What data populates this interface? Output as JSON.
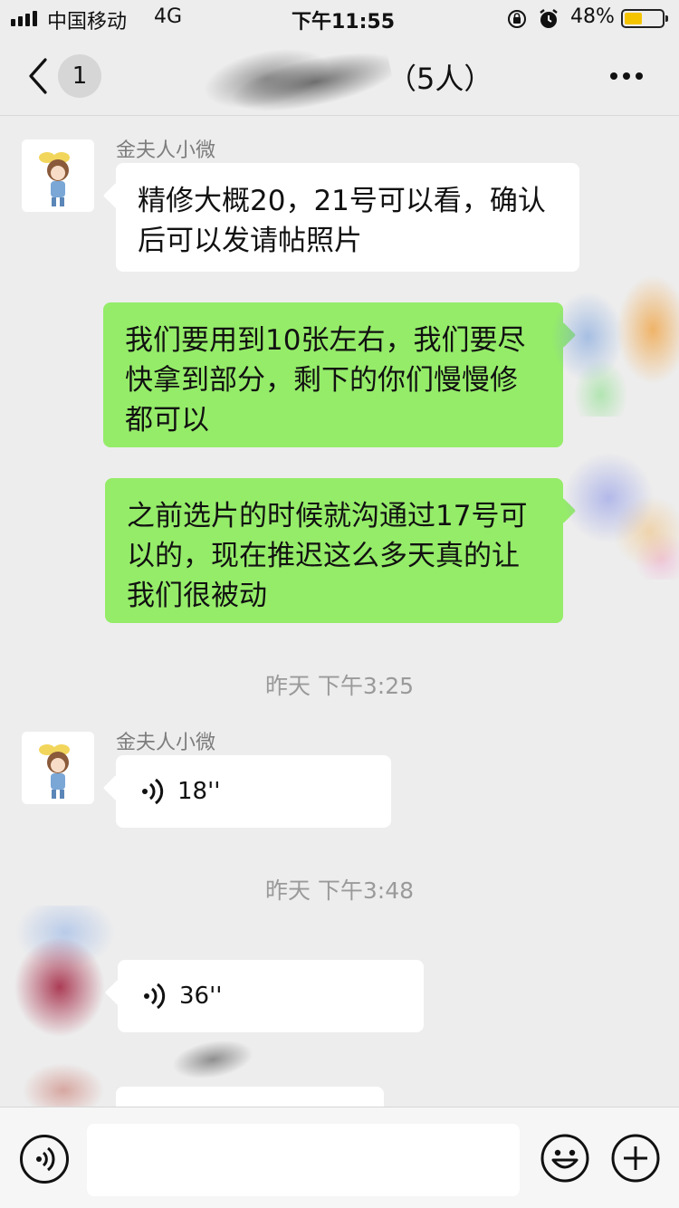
{
  "status_bar": {
    "carrier": "中国移动",
    "network": "4G",
    "time": "下午11:55",
    "battery_percent": "48%",
    "battery_level": 0.48,
    "icons": [
      "signal-icon",
      "rotation-lock-icon",
      "alarm-icon",
      "battery-icon"
    ]
  },
  "nav": {
    "back_icon": "chevron-left-icon",
    "unread_count": "1",
    "title_suffix": "（5人）",
    "more_icon": "more-dots-icon"
  },
  "messages": [
    {
      "type": "text",
      "direction": "in",
      "sender": "金夫人小微",
      "lines": [
        "精修大概20，21号可以看，确认",
        "后可以发请帖照片"
      ]
    },
    {
      "type": "text",
      "direction": "out",
      "lines": [
        "我们要用到10张左右，我们要尽",
        "快拿到部分，剩下的你们慢慢修",
        "都可以"
      ]
    },
    {
      "type": "text",
      "direction": "out",
      "lines": [
        "之前选片的时候就沟通过17号可",
        "以的，现在推迟这么多天真的让",
        "我们很被动"
      ]
    },
    {
      "type": "timestamp",
      "text": "昨天 下午3:25"
    },
    {
      "type": "voice",
      "direction": "in",
      "sender": "金夫人小微",
      "duration": "18''"
    },
    {
      "type": "timestamp",
      "text": "昨天 下午3:48"
    },
    {
      "type": "voice",
      "direction": "in",
      "duration": "36''"
    }
  ],
  "input_bar": {
    "voice_icon": "voice-mode-icon",
    "emoji_icon": "emoji-icon",
    "plus_icon": "plus-icon",
    "input_value": ""
  },
  "colors": {
    "background": "#ededed",
    "incoming_bubble": "#ffffff",
    "outgoing_bubble": "#95ec69",
    "battery": "#f5c400"
  }
}
